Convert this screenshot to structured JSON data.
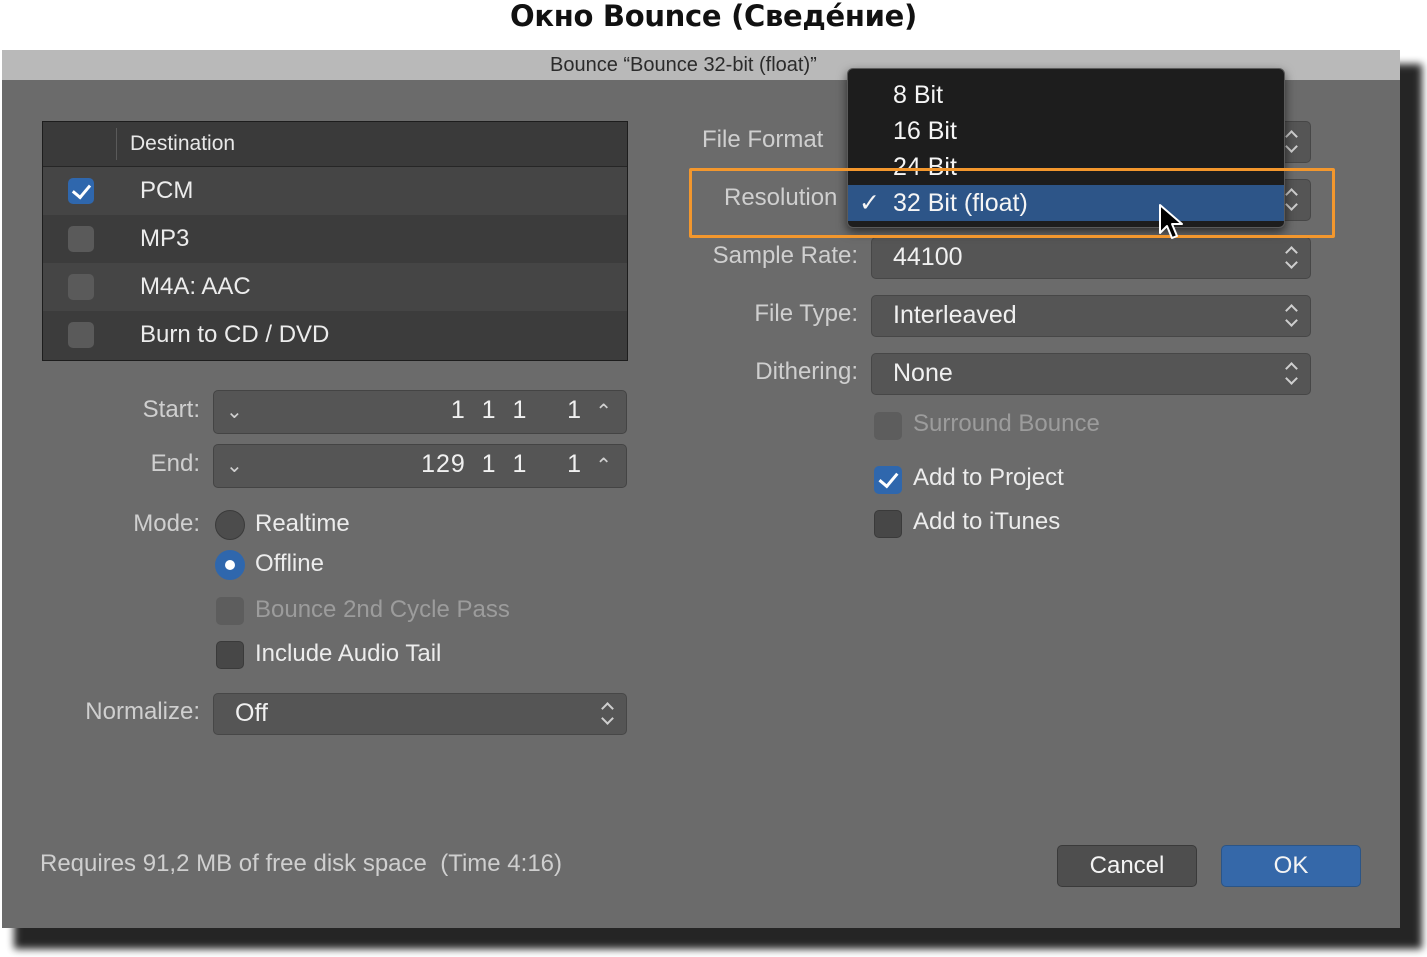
{
  "page_heading": "Окно Bounce (Сведе́ние)",
  "window": {
    "title": "Bounce “Bounce 32-bit (float)”"
  },
  "destination": {
    "header": "Destination",
    "items": [
      {
        "label": "PCM",
        "checked": true
      },
      {
        "label": "MP3",
        "checked": false
      },
      {
        "label": "M4A: AAC",
        "checked": false
      },
      {
        "label": "Burn to CD / DVD",
        "checked": false
      }
    ]
  },
  "range": {
    "start_label": "Start:",
    "start_value": "1  1  1     1",
    "end_label": "End:",
    "end_value": "129  1  1     1"
  },
  "mode": {
    "label": "Mode:",
    "options": [
      {
        "label": "Realtime",
        "selected": false
      },
      {
        "label": "Offline",
        "selected": true
      }
    ]
  },
  "options_left": {
    "bounce_2nd_cycle": "Bounce 2nd Cycle Pass",
    "include_audio_tail": "Include Audio Tail"
  },
  "normalize": {
    "label": "Normalize:",
    "value": "Off"
  },
  "format": {
    "file_format_label": "File Format",
    "resolution_label": "Resolution",
    "sample_rate_label": "Sample Rate:",
    "sample_rate_value": "44100",
    "file_type_label": "File Type:",
    "file_type_value": "Interleaved",
    "dithering_label": "Dithering:",
    "dithering_value": "None"
  },
  "options_right": {
    "surround_bounce": "Surround Bounce",
    "add_to_project": "Add to Project",
    "add_to_itunes": "Add to iTunes"
  },
  "resolution_menu": {
    "items": [
      "8 Bit",
      "16 Bit",
      "24 Bit",
      "32 Bit (float)"
    ],
    "selected_index": 3,
    "check_glyph": "✓"
  },
  "footer": {
    "disk_info": "Requires 91,2 MB of free disk space  (Time 4:16)",
    "cancel_label": "Cancel",
    "ok_label": "OK"
  },
  "colors": {
    "accent_blue": "#2f67ad",
    "highlight_orange": "#f3972d",
    "window_bg": "#6b6b6b"
  }
}
